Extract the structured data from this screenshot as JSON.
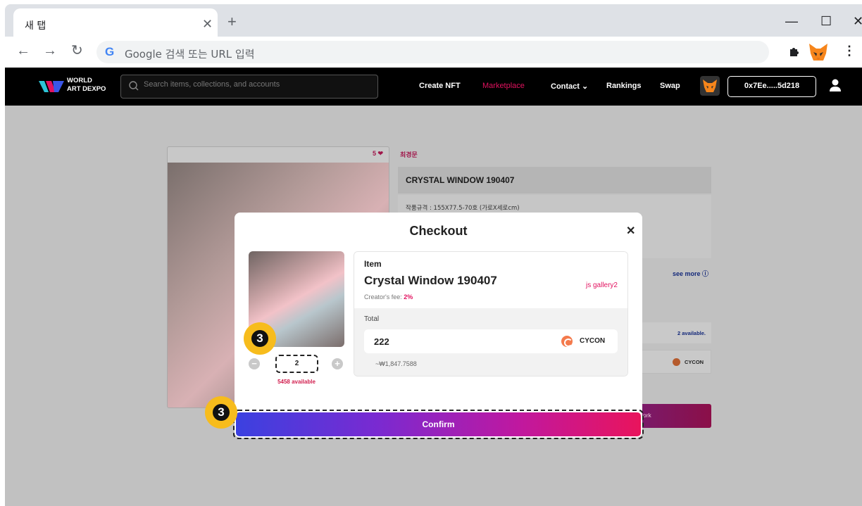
{
  "browser": {
    "tab_title": "새 탭",
    "tab_close": "✕",
    "new_tab": "+",
    "win_minimize": "—",
    "win_maximize": "☐",
    "win_close": "✕",
    "omnibox_text": "Google 검색 또는 URL 입력",
    "g_letter": "G"
  },
  "site": {
    "logo_line1": "WORLD",
    "logo_line2": "ART DEXPO",
    "search_placeholder": "Search items, collections, and accounts",
    "nav": [
      "Create NFT",
      "Marketplace",
      "Contact ⌄",
      "Rankings",
      "Swap"
    ],
    "wallet": "0x7Ee.....5d218"
  },
  "product": {
    "likes": "5 ❤",
    "artist": "최경문",
    "title": "CRYSTAL WINDOW 190407",
    "spec": "작품규격 : 155X77.5-70호 (가로X세로cm)",
    "see_more": "see more ⓘ",
    "available": "2 available.",
    "currency": "CYCON",
    "buy_label": "ork"
  },
  "checkout": {
    "title": "Checkout",
    "close": "✕",
    "item_label": "Item",
    "item_name": "Crystal Window 190407",
    "gallery": "js gallery2",
    "fee_label": "Creator's fee: ",
    "fee_value": "2%",
    "total_label": "Total",
    "total_value": "222",
    "currency": "CYCON",
    "krw": "~₩1,847.7588",
    "quantity": "2",
    "quantity_available": "5458 available",
    "minus": "−",
    "plus": "+",
    "confirm": "Confirm"
  },
  "annotations": {
    "step": "3"
  },
  "colors": {
    "accent": "#e2125f",
    "badge": "#f7bc1c",
    "header_bg": "#000000"
  }
}
